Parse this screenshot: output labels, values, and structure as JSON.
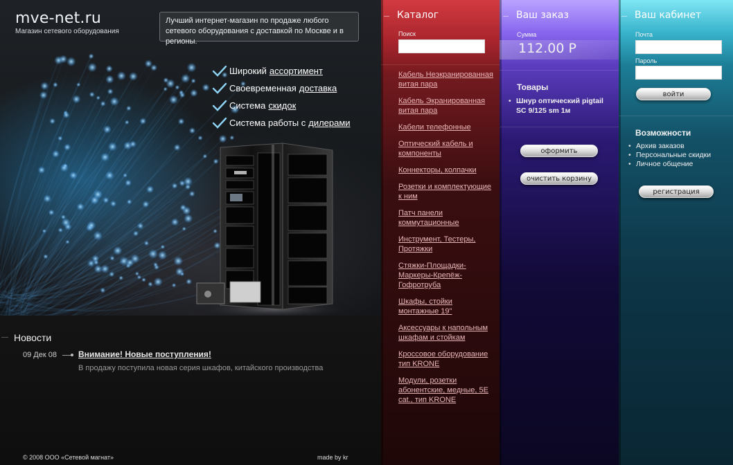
{
  "header": {
    "logo_title": "mve-net.ru",
    "logo_subtitle": "Магазин сетевого оборудования",
    "promo_text": "Лучший интернет-магазин по продаже любого сетевого оборудования с доставкой по Москве и в регионы."
  },
  "features": [
    {
      "prefix": "Широкий",
      "link": "ассортимент"
    },
    {
      "prefix": "Своевременная",
      "link": "доставка"
    },
    {
      "prefix": "Система",
      "link": "скидок"
    },
    {
      "prefix": "Система работы с",
      "link": "дилерами"
    }
  ],
  "news": {
    "heading": "Новости",
    "date": "09 Дек 08",
    "link": "Внимание! Новые поступления!",
    "text": "В продажу поступила новая серия шкафов, китайского производства"
  },
  "footer": {
    "copyright": "© 2008 ООО «Сетевой магнат»",
    "made_by": "made by kr"
  },
  "catalog": {
    "heading": "Каталог",
    "search_label": "Поиск",
    "search_value": "",
    "items": [
      "Кабель Неэкранированная витая пара",
      "Кабель Экранированная витая пара",
      "Кабели телефонные",
      "Оптический кабель и компоненты",
      "Коннекторы, колпачки",
      "Розетки и комплектующие к ним",
      "Патч панели коммутационные",
      "Инструмент, Тестеры, Протяжки",
      "Стяжки-Площадки-Маркеры-Крепёж-Гофротруба",
      "Шкафы, стойки монтажные 19\"",
      "Аксессуары к напольным шкафам и стойкам",
      "Кроссовое оборудование тип KRONE",
      "Модули, розетки абонентские, медные, 5Е cat., тип KRONE"
    ]
  },
  "order": {
    "heading": "Ваш заказ",
    "sum_label": "Сумма",
    "sum_value": "112.00 Р",
    "goods_heading": "Товары",
    "items": [
      "Шнур оптический pigtail SC 9/125 sm 1м"
    ],
    "checkout_button": "оформить",
    "clear_button": "очистить корзину"
  },
  "cabinet": {
    "heading": "Ваш кабинет",
    "email_label": "Почта",
    "email_value": "",
    "password_label": "Пароль",
    "password_value": "",
    "login_button": "войти",
    "features_heading": "Возможности",
    "features": [
      "Архив заказов",
      "Персональные скидки",
      "Личное общение"
    ],
    "register_button": "регистрация"
  },
  "colors": {
    "catalog_accent": "#d23a40",
    "order_accent": "#8866ee",
    "cabinet_accent": "#38b3cc",
    "fiber_blue": "#3fa9ff"
  }
}
